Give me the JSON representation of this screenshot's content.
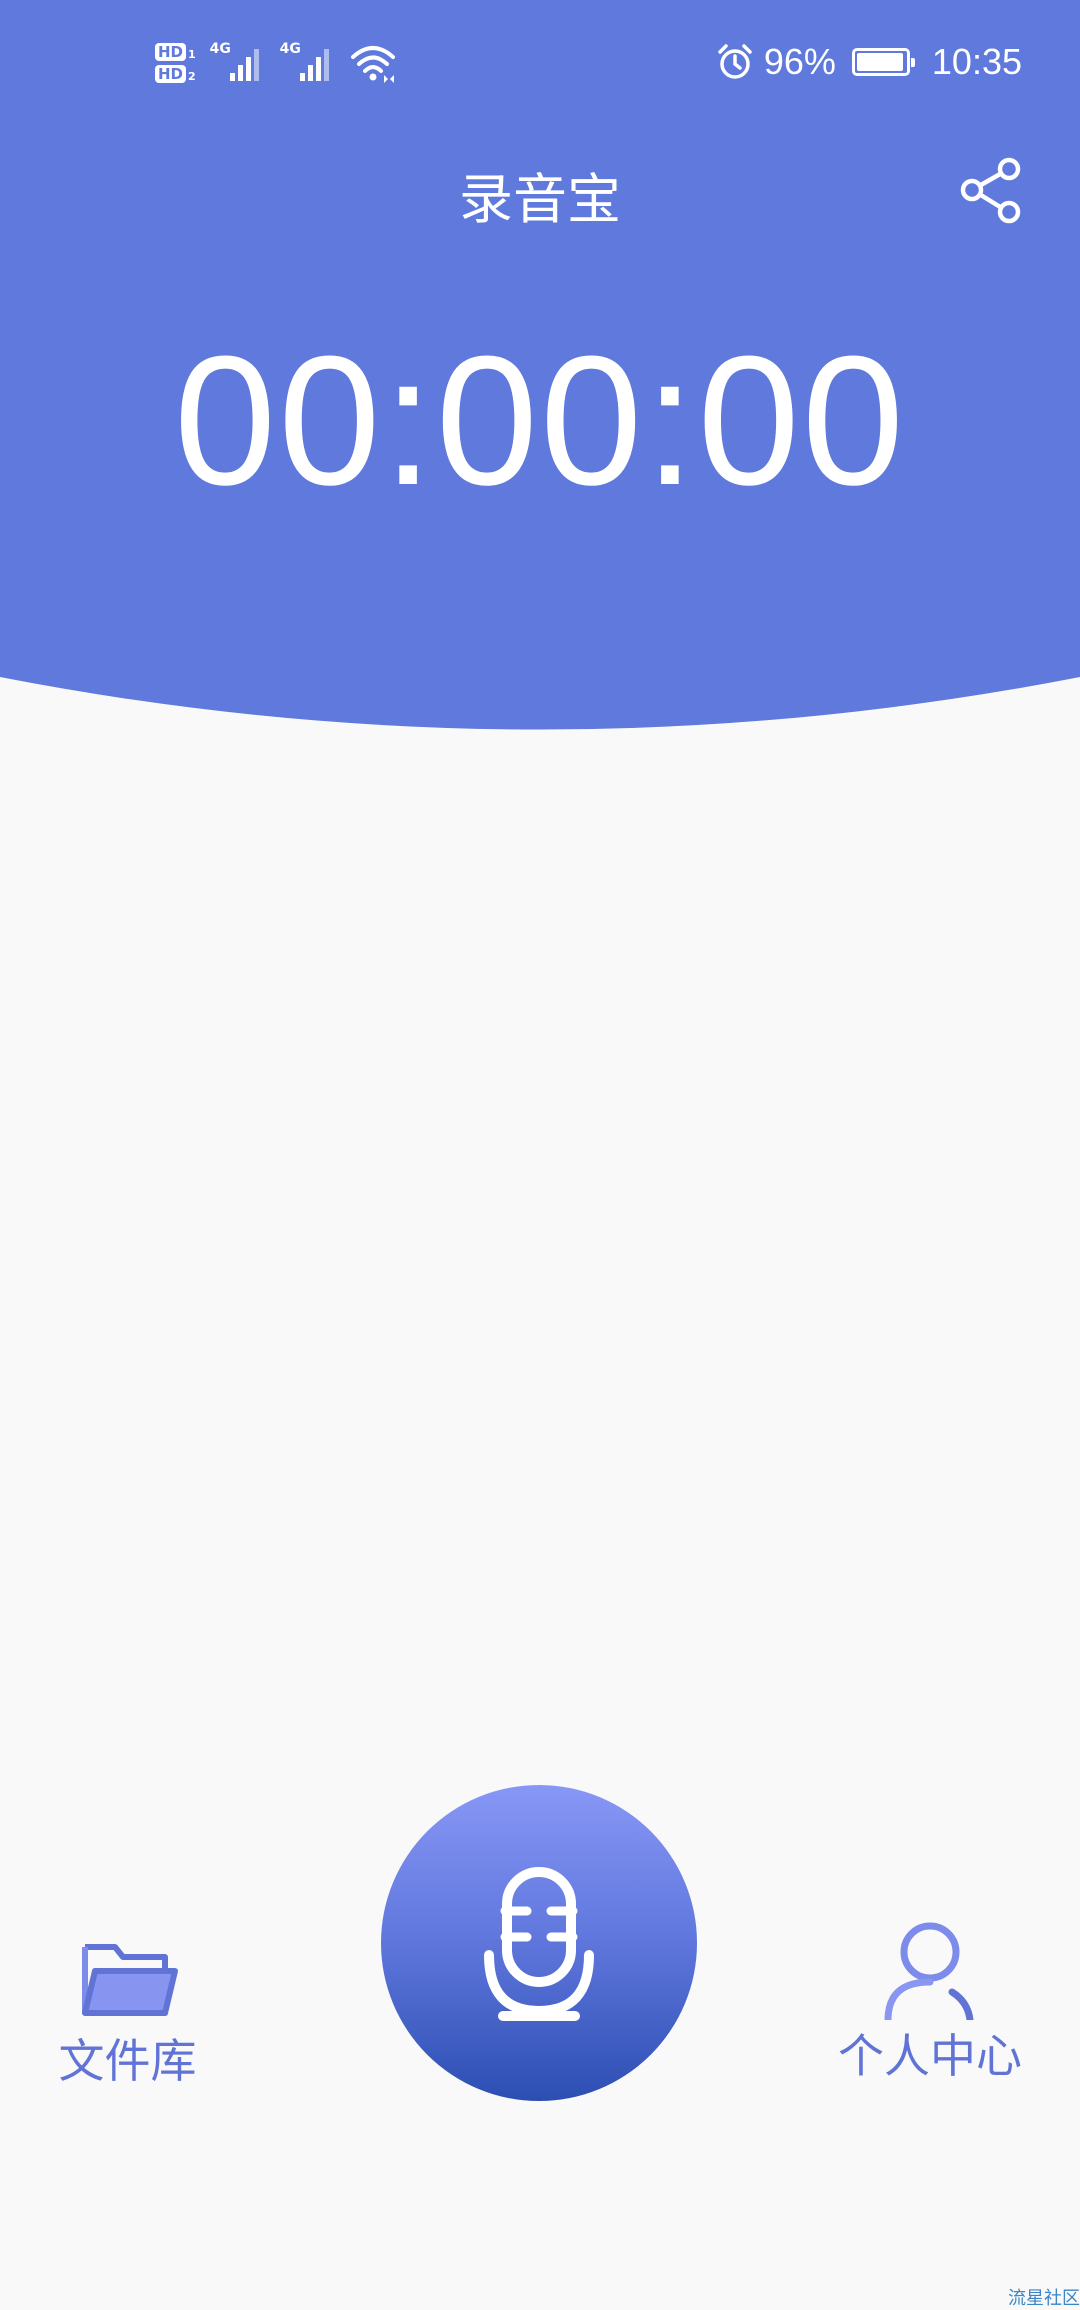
{
  "status_bar": {
    "hd1": "HD",
    "hd1_sub": "1",
    "hd2": "HD",
    "hd2_sub": "2",
    "network1": "4G",
    "network2": "4G",
    "battery_percent": "96%",
    "battery_level": 0.96,
    "time": "10:35",
    "icons": [
      "alarm-icon",
      "wifi-icon",
      "signal-icon",
      "battery-icon"
    ]
  },
  "header": {
    "title": "录音宝",
    "share_icon": "share-icon"
  },
  "timer": {
    "value": "00:00:00"
  },
  "controls": {
    "record_icon": "microphone-icon",
    "files_label": "文件库",
    "files_icon": "folder-icon",
    "profile_label": "个人中心",
    "profile_icon": "user-icon"
  },
  "watermark": {
    "text": "流星社区"
  },
  "colors": {
    "header_blue": "#5f79dc",
    "accent": "#6174d6",
    "background": "#f9f9f9"
  }
}
